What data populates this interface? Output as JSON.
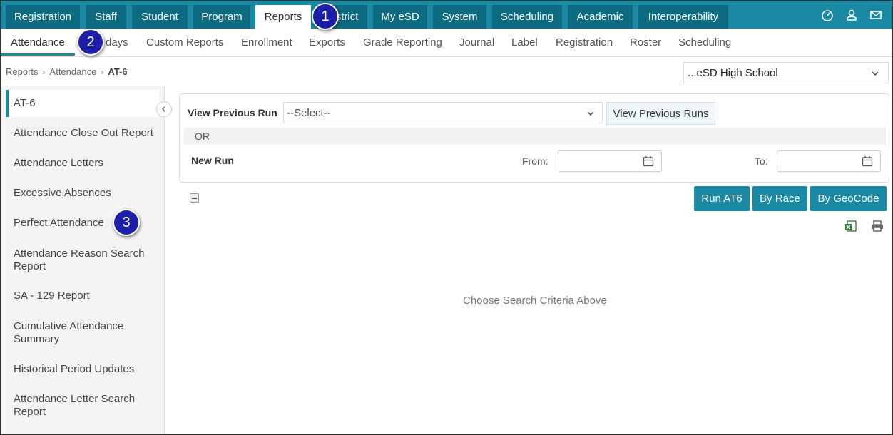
{
  "top_nav": {
    "tabs": [
      "Registration",
      "Staff",
      "Student",
      "Program",
      "Reports",
      "District",
      "My eSD",
      "System",
      "Scheduling",
      "Academic",
      "Interoperability"
    ],
    "active": "Reports",
    "icons": [
      "dashboard-icon",
      "user-icon",
      "mail-icon"
    ]
  },
  "sub_nav": {
    "items": [
      "Attendance",
      "Days",
      "Custom Reports",
      "Enrollment",
      "Exports",
      "Grade Reporting",
      "Journal",
      "Label",
      "Registration",
      "Roster",
      "Scheduling"
    ],
    "visible_text": [
      "Attendance",
      "days",
      "Custom Reports",
      "Enrollment",
      "Exports",
      "Grade Reporting",
      "Journal",
      "Label",
      "Registration",
      "Roster",
      "Scheduling"
    ],
    "active": "Attendance"
  },
  "breadcrumb": [
    "Reports",
    "Attendance",
    "AT-6"
  ],
  "school_select": {
    "value": "...eSD High School"
  },
  "sidebar": {
    "items": [
      "AT-6",
      "Attendance Close Out Report",
      "Attendance Letters",
      "Excessive Absences",
      "Perfect Attendance",
      "Attendance Reason Search Report",
      "SA - 129 Report",
      "Cumulative Attendance Summary",
      "Historical Period Updates",
      "Attendance Letter Search Report"
    ],
    "active": "AT-6"
  },
  "form": {
    "view_previous_run_label": "View Previous Run",
    "select_value": "--Select--",
    "view_previous_runs_button": "View Previous Runs",
    "or_label": "OR",
    "new_run_label": "New Run",
    "from_label": "From:",
    "to_label": "To:",
    "from_value": "",
    "to_value": ""
  },
  "actions": {
    "run_at6": "Run AT6",
    "by_race": "By Race",
    "by_geocode": "By GeoCode"
  },
  "empty_message": "Choose Search Criteria Above",
  "callouts": [
    "1",
    "2",
    "3"
  ],
  "colors": {
    "accent": "#1a8aa4",
    "tab_dark": "#0d6b81",
    "callout": "#1d1fa8"
  }
}
